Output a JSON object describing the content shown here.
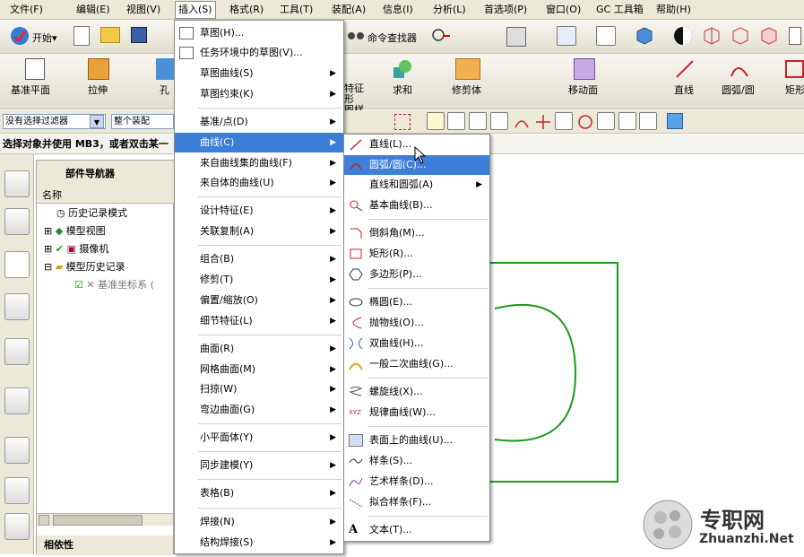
{
  "menubar": {
    "items": [
      "文件(F)",
      "编辑(E)",
      "视图(V)",
      "插入(S)",
      "格式(R)",
      "工具(T)",
      "装配(A)",
      "信息(I)",
      "分析(L)",
      "首选项(P)",
      "窗口(O)",
      "GC 工具箱",
      "帮助(H)"
    ]
  },
  "toolbar1": {
    "start_label": "开始▾",
    "finder_label": "命令查找器"
  },
  "toolbar2": {
    "items": [
      "基准平面",
      "拉伸",
      "孔",
      "求和",
      "修剪体",
      "移动面",
      "直线",
      "圆弧/圆",
      "矩形"
    ],
    "feature_label": "特征形\n图样"
  },
  "filter": {
    "value": "没有选择过滤器",
    "assembly": "整个装配"
  },
  "status": {
    "text": "选择对象并使用 MB3，或者双击某一"
  },
  "navigator": {
    "title": "部件导航器",
    "column": "名称",
    "items": [
      "历史记录模式",
      "模型视图",
      "摄像机",
      "模型历史记录",
      "基准坐标系 ("
    ],
    "footer": "相依性"
  },
  "insert_menu": {
    "items": [
      "草图(H)...",
      "任务环境中的草图(V)...",
      "草图曲线(S)",
      "草图约束(K)",
      "基准/点(D)",
      "曲线(C)",
      "来自曲线集的曲线(F)",
      "来自体的曲线(U)",
      "设计特征(E)",
      "关联复制(A)",
      "组合(B)",
      "修剪(T)",
      "偏置/缩放(O)",
      "细节特征(L)",
      "曲面(R)",
      "网格曲面(M)",
      "扫掠(W)",
      "弯边曲面(G)",
      "小平面体(Y)",
      "同步建模(Y)",
      "表格(B)",
      "焊接(N)",
      "结构焊接(S)"
    ]
  },
  "curve_menu": {
    "items": [
      "直线(L)...",
      "圆弧/圆(C)...",
      "直线和圆弧(A)",
      "基本曲线(B)...",
      "倒斜角(M)...",
      "矩形(R)...",
      "多边形(P)...",
      "椭圆(E)...",
      "抛物线(O)...",
      "双曲线(H)...",
      "一般二次曲线(G)...",
      "螺旋线(X)...",
      "规律曲线(W)...",
      "表面上的曲线(U)...",
      "样条(S)...",
      "艺术样条(D)...",
      "拟合样条(F)...",
      "文本(T)..."
    ]
  },
  "watermark": {
    "title": "专职网",
    "url": "Zhuanzhi.Net"
  },
  "colors": {
    "highlight": "#3d7fd8",
    "geometry": "#1a9a1a"
  }
}
